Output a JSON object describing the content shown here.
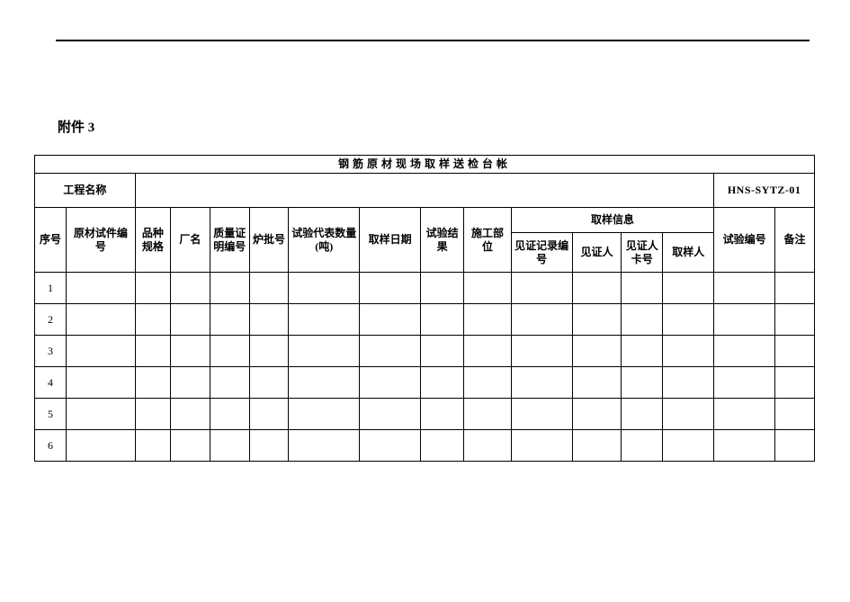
{
  "attachment_label": "附件 3",
  "title": "钢筋原材现场取样送检台帐",
  "project_name_label": "工程名称",
  "form_code": "HNS-SYTZ-01",
  "headers": {
    "seq": "序号",
    "material_sample_no": "原材试件编号",
    "variety_spec": "品种规格",
    "factory": "厂名",
    "quality_cert_no": "质量证明编号",
    "heat_no": "炉批号",
    "represented_qty": "试验代表数量(吨)",
    "sampling_date": "取样日期",
    "test_result": "试验结果",
    "construction_part": "施工部位",
    "sampling_info": "取样信息",
    "witness_record_no": "见证记录编号",
    "witness": "见证人",
    "witness_card_no": "见证人卡号",
    "sampler": "取样人",
    "test_no": "试验编号",
    "remark": "备注"
  },
  "rows": [
    {
      "seq": "1"
    },
    {
      "seq": "2"
    },
    {
      "seq": "3"
    },
    {
      "seq": "4"
    },
    {
      "seq": "5"
    },
    {
      "seq": "6"
    }
  ]
}
